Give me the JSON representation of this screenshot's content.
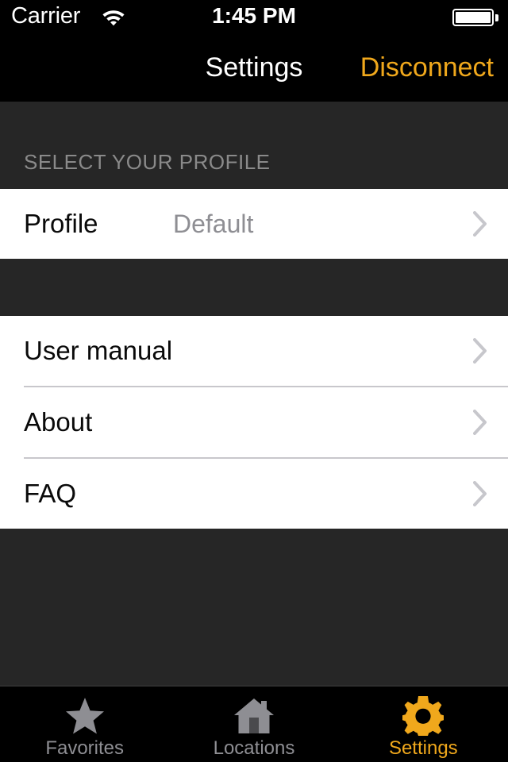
{
  "status_bar": {
    "carrier": "Carrier",
    "wifi_icon": "wifi-icon",
    "time": "1:45 PM",
    "battery_icon": "battery-full-icon"
  },
  "nav_bar": {
    "title": "Settings",
    "action_label": "Disconnect",
    "action_color": "#F0A81C"
  },
  "sections": [
    {
      "header": "SELECT YOUR PROFILE",
      "rows": [
        {
          "title": "Profile",
          "value": "Default",
          "accessory": "chevron-right-icon"
        }
      ]
    },
    {
      "header": "",
      "rows": [
        {
          "title": "User manual",
          "value": "",
          "accessory": "chevron-right-icon"
        },
        {
          "title": "About",
          "value": "",
          "accessory": "chevron-right-icon"
        },
        {
          "title": "FAQ",
          "value": "",
          "accessory": "chevron-right-icon"
        }
      ]
    }
  ],
  "tab_bar": {
    "items": [
      {
        "label": "Favorites",
        "icon": "star-icon",
        "active": false
      },
      {
        "label": "Locations",
        "icon": "home-icon",
        "active": false
      },
      {
        "label": "Settings",
        "icon": "gear-icon",
        "active": true
      }
    ],
    "active_color": "#F0A81C",
    "inactive_color": "#8E8E93"
  },
  "colors": {
    "background_dark": "#262626",
    "row_background": "#FFFFFF",
    "separator": "#C8C7CC",
    "chevron": "#C7C7CC",
    "bar_black": "#000000"
  }
}
